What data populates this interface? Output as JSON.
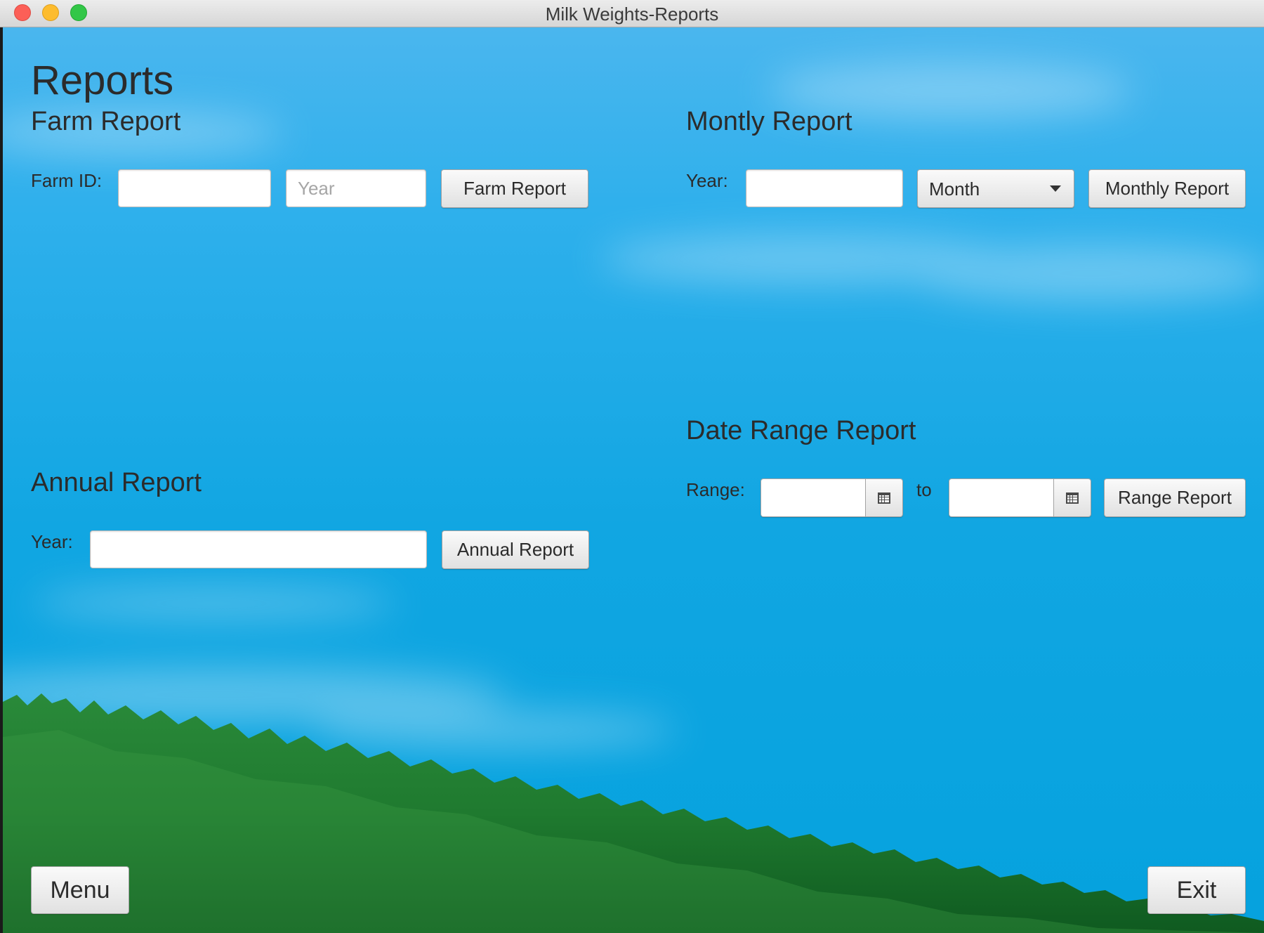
{
  "window": {
    "title": "Milk Weights-Reports"
  },
  "page": {
    "title": "Reports"
  },
  "farm_report": {
    "heading": "Farm Report",
    "farm_id_label": "Farm ID:",
    "farm_id_value": "",
    "year_placeholder": "Year",
    "year_value": "",
    "button": "Farm Report"
  },
  "monthly_report": {
    "heading": "Montly Report",
    "year_label": "Year:",
    "year_value": "",
    "month_selected": "Month",
    "button": "Monthly Report"
  },
  "date_range_report": {
    "heading": "Date Range Report",
    "range_label": "Range:",
    "start_value": "",
    "to_label": "to",
    "end_value": "",
    "button": "Range Report",
    "calendar_icon": "calendar-icon"
  },
  "annual_report": {
    "heading": "Annual Report",
    "year_label": "Year:",
    "year_value": "",
    "button": "Annual Report"
  },
  "footer": {
    "menu_button": "Menu",
    "exit_button": "Exit"
  },
  "colors": {
    "sky": "#11a6e2",
    "forest": "#1c7a2e",
    "traffic_close": "#fc5f57",
    "traffic_min": "#fdbc2e",
    "traffic_max": "#33c748"
  }
}
